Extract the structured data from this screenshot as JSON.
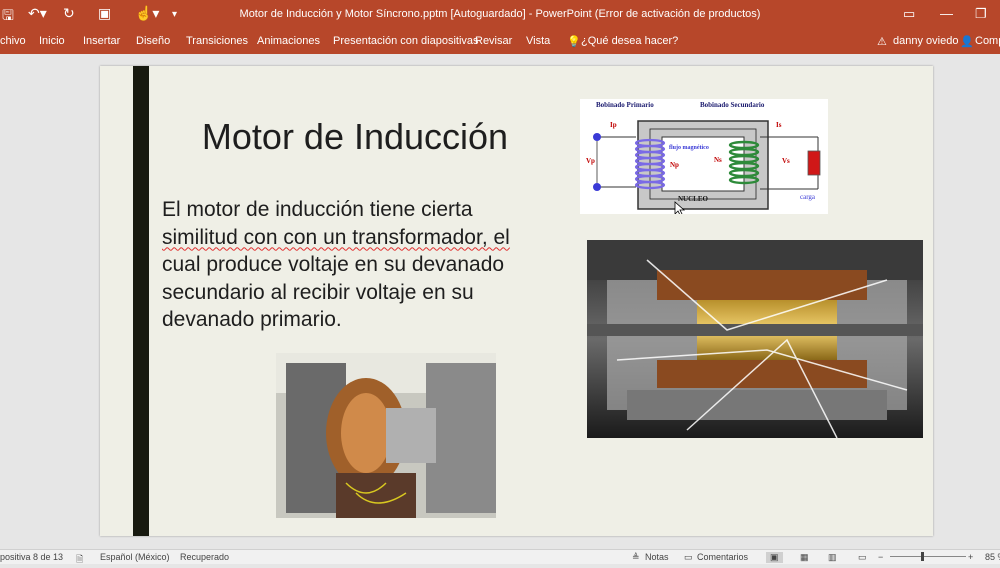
{
  "titlebar": {
    "title": "Motor de Inducción y Motor Síncrono.pptm [Autoguardado]  -  PowerPoint (Error de activación de productos)"
  },
  "ribbon": {
    "tabs": [
      "chivo",
      "Inicio",
      "Insertar",
      "Diseño",
      "Transiciones",
      "Animaciones",
      "Presentación con diapositivas",
      "Revisar",
      "Vista"
    ],
    "tell_me": "¿Qué desea hacer?",
    "user": "danny oviedo",
    "share": "Comp"
  },
  "slide": {
    "title": "Motor de Inducción",
    "body_lines": [
      "El motor de inducción tiene cierta",
      "similitud con con un transformador, el",
      "cual produce voltaje en su devanado",
      "secundario al recibir voltaje en su",
      "devanado primario."
    ],
    "diagram": {
      "primary_label": "Bobinado Primario",
      "secondary_label": "Bobinado Secundario",
      "ip": "Ip",
      "is": "Is",
      "vp": "Vp",
      "vs": "Vs",
      "np": "Np",
      "ns": "Ns",
      "flux": "flujo magnético",
      "core": "NUCLEO",
      "load": "carga"
    }
  },
  "statusbar": {
    "slide_info": "positiva 8 de 13",
    "language": "Español (México)",
    "recovered": "Recuperado",
    "notes": "Notas",
    "comments": "Comentarios",
    "zoom": "85 %"
  },
  "colors": {
    "accent": "#b7472a",
    "slide_bg": "#efefe6",
    "slide_bar": "#181a10"
  }
}
